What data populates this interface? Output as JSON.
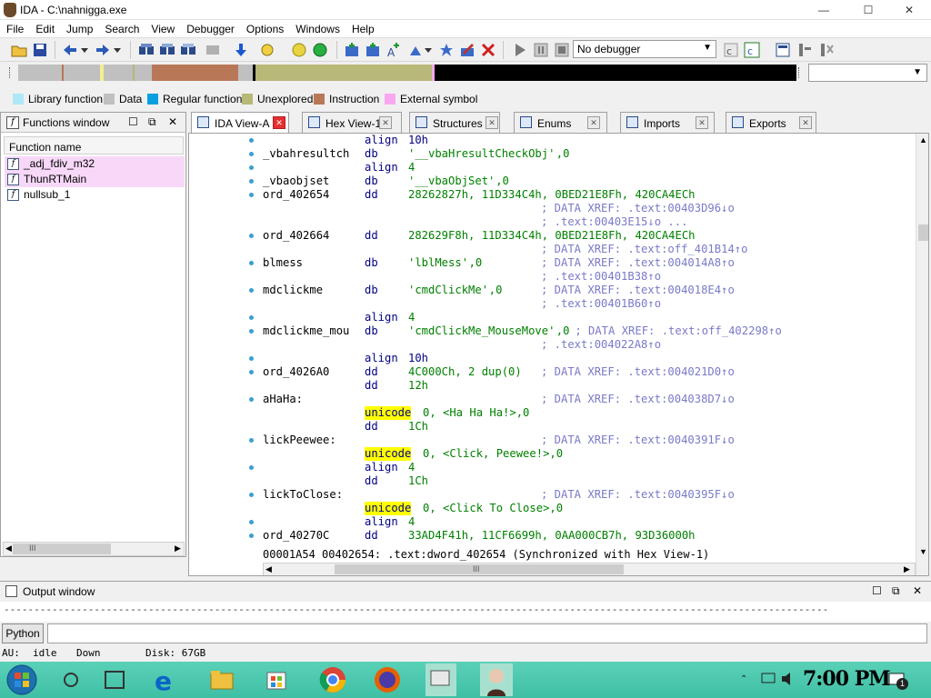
{
  "window": {
    "title": "IDA - C:\\nahnigga.exe",
    "minimize": "—",
    "maximize": "☐",
    "close": "✕"
  },
  "menu": [
    "File",
    "Edit",
    "Jump",
    "Search",
    "View",
    "Debugger",
    "Options",
    "Windows",
    "Help"
  ],
  "toolbar": {
    "debugger_select": "No debugger"
  },
  "legend": [
    {
      "label": "Library function",
      "color": "#aee8f8"
    },
    {
      "label": "Data",
      "color": "#c0c0c0"
    },
    {
      "label": "Regular function",
      "color": "#0aa0e0"
    },
    {
      "label": "Unexplored",
      "color": "#b8b878"
    },
    {
      "label": "Instruction",
      "color": "#b87858"
    },
    {
      "label": "External symbol",
      "color": "#f8a8f0"
    }
  ],
  "functions_window": {
    "title": "Functions window",
    "column": "Function name",
    "items": [
      "_adj_fdiv_m32",
      "ThunRTMain",
      "nullsub_1"
    ],
    "scroll_glyph": "III"
  },
  "tabs": [
    "IDA View-A",
    "Hex View-1",
    "Structures",
    "Enums",
    "Imports",
    "Exports"
  ],
  "disasm": {
    "lines": [
      {
        "label": "",
        "op": "align",
        "args": [
          {
            "t": "10h",
            "c": "dir"
          }
        ],
        "cmt": ""
      },
      {
        "label": "_vbahresultch",
        "op": "db",
        "args": [
          {
            "t": "'__vbaHresultCheckObj'",
            "c": "str"
          },
          {
            "t": ",0",
            "c": "num"
          }
        ],
        "cmt": ""
      },
      {
        "label": "",
        "op": "align",
        "args": [
          {
            "t": "4",
            "c": "num"
          }
        ],
        "cmt": ""
      },
      {
        "label": "_vbaobjset",
        "op": "db",
        "args": [
          {
            "t": "'__vbaObjSet'",
            "c": "str"
          },
          {
            "t": ",0",
            "c": "num"
          }
        ],
        "cmt": ""
      },
      {
        "label": "ord_402654",
        "op": "dd",
        "args": [
          {
            "t": "28262827h, 11D334C4h, 0BED21E8Fh, 420CA4ECh",
            "c": "num"
          }
        ],
        "cmt": ""
      },
      {
        "label": "",
        "op": "",
        "args": [],
        "cmt": "; DATA XREF: .text:00403D96↓o"
      },
      {
        "label": "",
        "op": "",
        "args": [],
        "cmt": "; .text:00403E15↓o ..."
      },
      {
        "label": "ord_402664",
        "op": "dd",
        "args": [
          {
            "t": "282629F8h, 11D334C4h, 0BED21E8Fh, 420CA4ECh",
            "c": "num"
          }
        ],
        "cmt": ""
      },
      {
        "label": "",
        "op": "",
        "args": [],
        "cmt": "; DATA XREF: .text:off_401B14↑o"
      },
      {
        "label": "blmess",
        "op": "db",
        "args": [
          {
            "t": "'lblMess'",
            "c": "str"
          },
          {
            "t": ",0",
            "c": "num"
          }
        ],
        "cmt": "; DATA XREF: .text:004014A8↑o"
      },
      {
        "label": "",
        "op": "",
        "args": [],
        "cmt": "; .text:00401B38↑o"
      },
      {
        "label": "mdclickme",
        "op": "db",
        "args": [
          {
            "t": "'cmdClickMe'",
            "c": "str"
          },
          {
            "t": ",0",
            "c": "num"
          }
        ],
        "cmt": "; DATA XREF: .text:004018E4↑o"
      },
      {
        "label": "",
        "op": "",
        "args": [],
        "cmt": "; .text:00401B60↑o"
      },
      {
        "label": "",
        "op": "align",
        "args": [
          {
            "t": "4",
            "c": "num"
          }
        ],
        "cmt": ""
      },
      {
        "label": "mdclickme_mou",
        "op": "db",
        "args": [
          {
            "t": "'cmdClickMe_MouseMove'",
            "c": "str"
          },
          {
            "t": ",0",
            "c": "num"
          }
        ],
        "cmt": " ; DATA XREF: .text:off_402298↑o"
      },
      {
        "label": "",
        "op": "",
        "args": [],
        "cmt": "; .text:004022A8↑o"
      },
      {
        "label": "",
        "op": "align",
        "args": [
          {
            "t": "10h",
            "c": "dir"
          }
        ],
        "cmt": ""
      },
      {
        "label": "ord_4026A0",
        "op": "dd",
        "args": [
          {
            "t": "4C000Ch, 2 dup(0)",
            "c": "num"
          }
        ],
        "cmt": "; DATA XREF: .text:004021D0↑o"
      },
      {
        "label": "",
        "op": "dd",
        "args": [
          {
            "t": "12h",
            "c": "num"
          }
        ],
        "cmt": ""
      },
      {
        "label": "aHaHa:",
        "op": "",
        "args": [],
        "cmt": "; DATA XREF: .text:004038D7↓o"
      },
      {
        "label": "",
        "op": "unicode",
        "args": [
          {
            "t": "0, <Ha Ha Ha!>,0",
            "c": "str"
          }
        ],
        "cmt": ""
      },
      {
        "label": "",
        "op": "dd",
        "args": [
          {
            "t": "1Ch",
            "c": "num"
          }
        ],
        "cmt": ""
      },
      {
        "label": "lickPeewee:",
        "op": "",
        "args": [],
        "cmt": "; DATA XREF: .text:0040391F↓o"
      },
      {
        "label": "",
        "op": "unicode",
        "args": [
          {
            "t": "0, <Click, Peewee!>,0",
            "c": "str"
          }
        ],
        "cmt": ""
      },
      {
        "label": "",
        "op": "align",
        "args": [
          {
            "t": "4",
            "c": "num"
          }
        ],
        "cmt": ""
      },
      {
        "label": "",
        "op": "dd",
        "args": [
          {
            "t": "1Ch",
            "c": "num"
          }
        ],
        "cmt": ""
      },
      {
        "label": "lickToClose:",
        "op": "",
        "args": [],
        "cmt": "; DATA XREF: .text:0040395F↓o"
      },
      {
        "label": "",
        "op": "unicode",
        "args": [
          {
            "t": "0, <Click To Close>,0",
            "c": "str"
          }
        ],
        "cmt": ""
      },
      {
        "label": "",
        "op": "align",
        "args": [
          {
            "t": "4",
            "c": "num"
          }
        ],
        "cmt": ""
      },
      {
        "label": "ord_40270C",
        "op": "dd",
        "args": [
          {
            "t": "33AD4F41h, 11CF6699h, 0AA000CB7h, 93D36000h",
            "c": "num"
          }
        ],
        "cmt": ""
      }
    ],
    "status_line": "00001A54 00402654: .text:dword_402654 (Synchronized with Hex View-1)",
    "hscroll_glyph": "III"
  },
  "output_window": {
    "title": "Output window",
    "text": "-----------------------------------------------------------------------------------------------------------------------------------------"
  },
  "python_button": "Python",
  "statusbar": {
    "au_label": "AU:",
    "au_value": "idle",
    "direction": "Down",
    "disk": "Disk: 67GB"
  },
  "taskbar": {
    "time": "7:00 PM",
    "notification_count": "1"
  }
}
